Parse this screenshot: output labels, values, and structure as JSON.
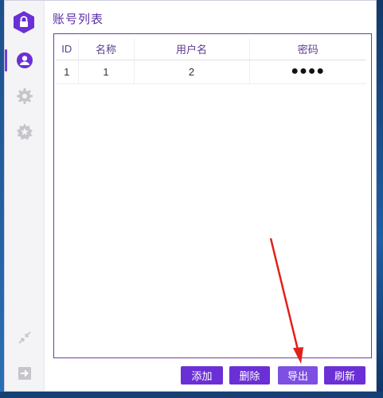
{
  "title": "账号列表",
  "sidebar": {
    "items": [
      {
        "name": "accounts",
        "icon": "user-icon",
        "active": true
      },
      {
        "name": "settings",
        "icon": "gear-icon",
        "active": false
      },
      {
        "name": "favorites",
        "icon": "star-badge-icon",
        "active": false
      }
    ],
    "bottom_items": [
      {
        "name": "collapse",
        "icon": "shrink-icon"
      },
      {
        "name": "logout",
        "icon": "logout-icon"
      }
    ]
  },
  "table": {
    "headers": [
      "ID",
      "名称",
      "用户名",
      "密码"
    ],
    "rows": [
      {
        "id": "1",
        "name": "1",
        "username": "2",
        "password": "●●●●"
      }
    ]
  },
  "buttons": {
    "add": "添加",
    "delete": "删除",
    "export": "导出",
    "refresh": "刷新"
  },
  "colors": {
    "accent": "#6b2fd6",
    "title": "#5b2ea6",
    "annotation": "#e0201b"
  }
}
